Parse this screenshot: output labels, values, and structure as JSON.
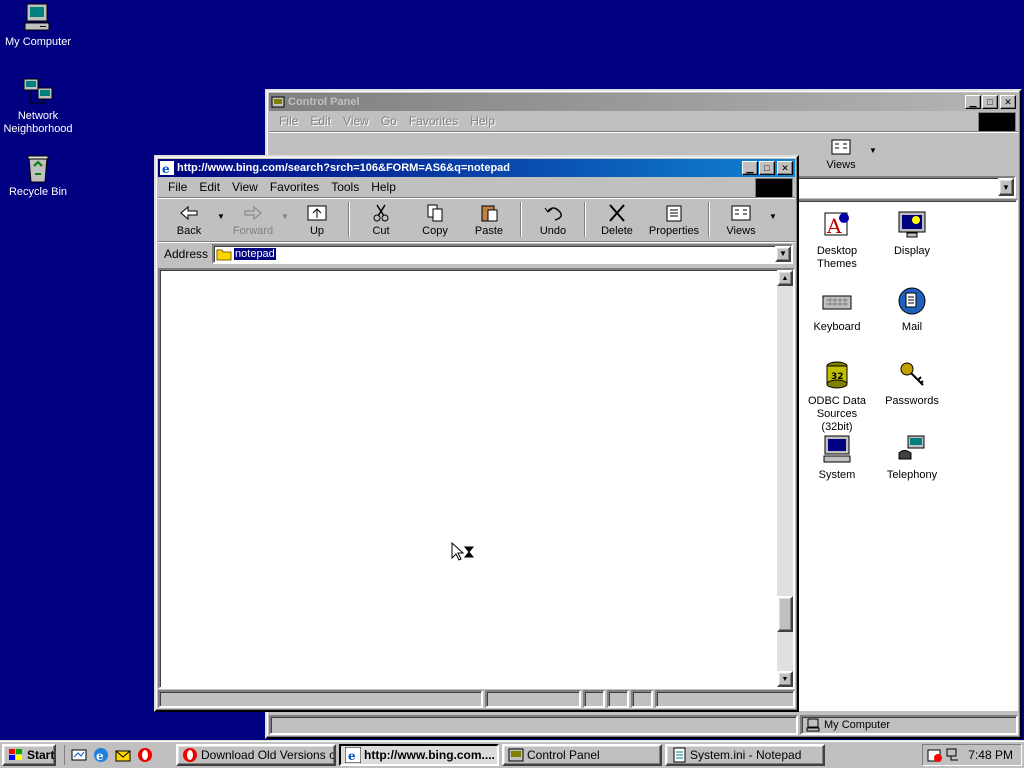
{
  "desktop": {
    "icons": [
      {
        "label": "My Computer"
      },
      {
        "label": "Network\nNeighborhood"
      },
      {
        "label": "Recycle Bin"
      }
    ]
  },
  "control_panel": {
    "title": "Control Panel",
    "menu": [
      "File",
      "Edit",
      "View",
      "Go",
      "Favorites",
      "Help"
    ],
    "views_label": "Views",
    "items": [
      {
        "label": "Desktop Themes"
      },
      {
        "label": "Display"
      },
      {
        "label": "Keyboard"
      },
      {
        "label": "Mail"
      },
      {
        "label": "ODBC Data Sources (32bit)"
      },
      {
        "label": "Passwords"
      },
      {
        "label": "System"
      },
      {
        "label": "Telephony"
      }
    ],
    "status_location": "My Computer"
  },
  "browser": {
    "title": "http://www.bing.com/search?srch=106&FORM=AS6&q=notepad",
    "menu": [
      "File",
      "Edit",
      "View",
      "Favorites",
      "Tools",
      "Help"
    ],
    "toolbar": {
      "back": "Back",
      "forward": "Forward",
      "up": "Up",
      "cut": "Cut",
      "copy": "Copy",
      "paste": "Paste",
      "undo": "Undo",
      "delete": "Delete",
      "properties": "Properties",
      "views": "Views"
    },
    "address_label": "Address",
    "address_value": "notepad"
  },
  "taskbar": {
    "start_label": "Start",
    "tasks": [
      {
        "label": "Download Old Versions of ..."
      },
      {
        "label": "http://www.bing.com...."
      },
      {
        "label": "Control Panel"
      },
      {
        "label": "System.ini - Notepad"
      }
    ],
    "clock": "7:48 PM"
  },
  "colors": {
    "desktop": "#000080",
    "titlebar_active": "#000080",
    "titlebar_inactive": "#808080",
    "face": "#c0c0c0",
    "selection": "#000080"
  }
}
